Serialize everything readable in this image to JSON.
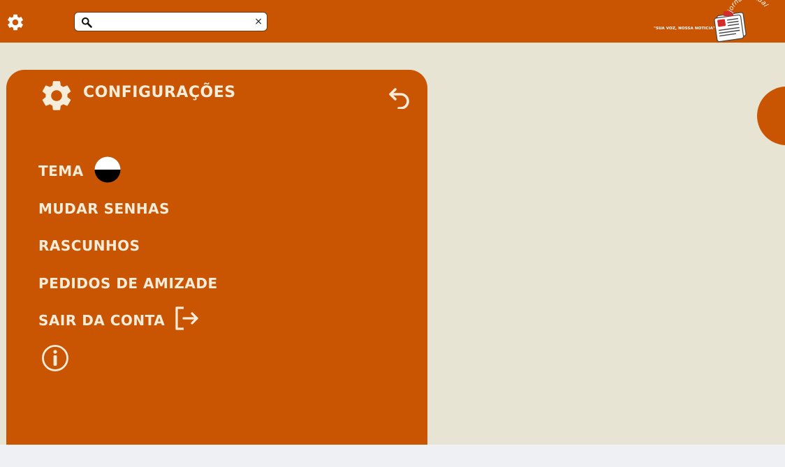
{
  "header": {
    "search": {
      "placeholder": "",
      "value": "",
      "clear_label": "×"
    },
    "brand": {
      "tagline": "\"SUA VOZ, NOSSA NOTICIA\"",
      "logo_text": "jornal virtual"
    }
  },
  "settings": {
    "title": "CONFIGURAÇÕES",
    "items": [
      {
        "label": "TEMA"
      },
      {
        "label": "MUDAR SENHAS"
      },
      {
        "label": "RASCUNHOS"
      },
      {
        "label": "PEDIDOS DE AMIZADE"
      },
      {
        "label": "SAIR DA CONTA"
      }
    ]
  },
  "icons": {
    "settings": "gear-icon",
    "search": "search-icon",
    "clear": "close-icon",
    "back": "undo-arrow-icon",
    "theme": "half-circle-theme-icon",
    "logout": "logout-icon",
    "info": "info-icon",
    "newspaper": "newspaper-icon"
  },
  "colors": {
    "primary": "#c95402",
    "background": "#e7e4d3",
    "panel_text": "#f5ecd9"
  }
}
